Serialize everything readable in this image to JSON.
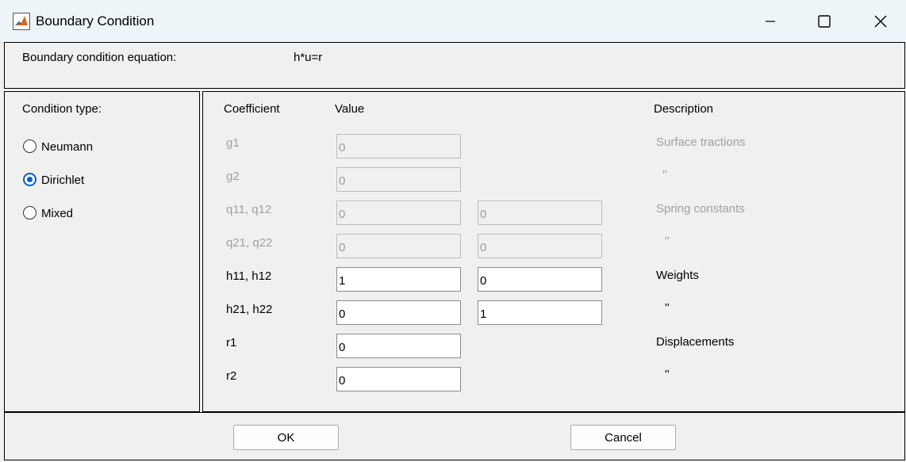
{
  "window": {
    "title": "Boundary Condition"
  },
  "equation": {
    "label": "Boundary condition equation:",
    "value": "h*u=r"
  },
  "condition_type": {
    "label": "Condition type:",
    "options": [
      {
        "label": "Neumann",
        "checked": false
      },
      {
        "label": "Dirichlet",
        "checked": true
      },
      {
        "label": "Mixed",
        "checked": false
      }
    ]
  },
  "table": {
    "headers": {
      "coefficient": "Coefficient",
      "value": "Value",
      "description": "Description"
    },
    "rows": [
      {
        "coef": "g1",
        "v1": "0",
        "v2": null,
        "desc": "Surface tractions",
        "enabled": false
      },
      {
        "coef": "g2",
        "v1": "0",
        "v2": null,
        "desc": "''",
        "enabled": false
      },
      {
        "coef": "q11, q12",
        "v1": "0",
        "v2": "0",
        "desc": "Spring constants",
        "enabled": false
      },
      {
        "coef": "q21, q22",
        "v1": "0",
        "v2": "0",
        "desc": "''",
        "enabled": false
      },
      {
        "coef": "h11, h12",
        "v1": "1",
        "v2": "0",
        "desc": "Weights",
        "enabled": true
      },
      {
        "coef": "h21, h22",
        "v1": "0",
        "v2": "1",
        "desc": "''",
        "enabled": true
      },
      {
        "coef": "r1",
        "v1": "0",
        "v2": null,
        "desc": "Displacements",
        "enabled": true
      },
      {
        "coef": "r2",
        "v1": "0",
        "v2": null,
        "desc": "''",
        "enabled": true
      }
    ]
  },
  "buttons": {
    "ok": "OK",
    "cancel": "Cancel"
  },
  "colors": {
    "accent": "#0a61c2",
    "disabled_text": "#a0a0a0",
    "titlebar": "#eef5f9"
  }
}
